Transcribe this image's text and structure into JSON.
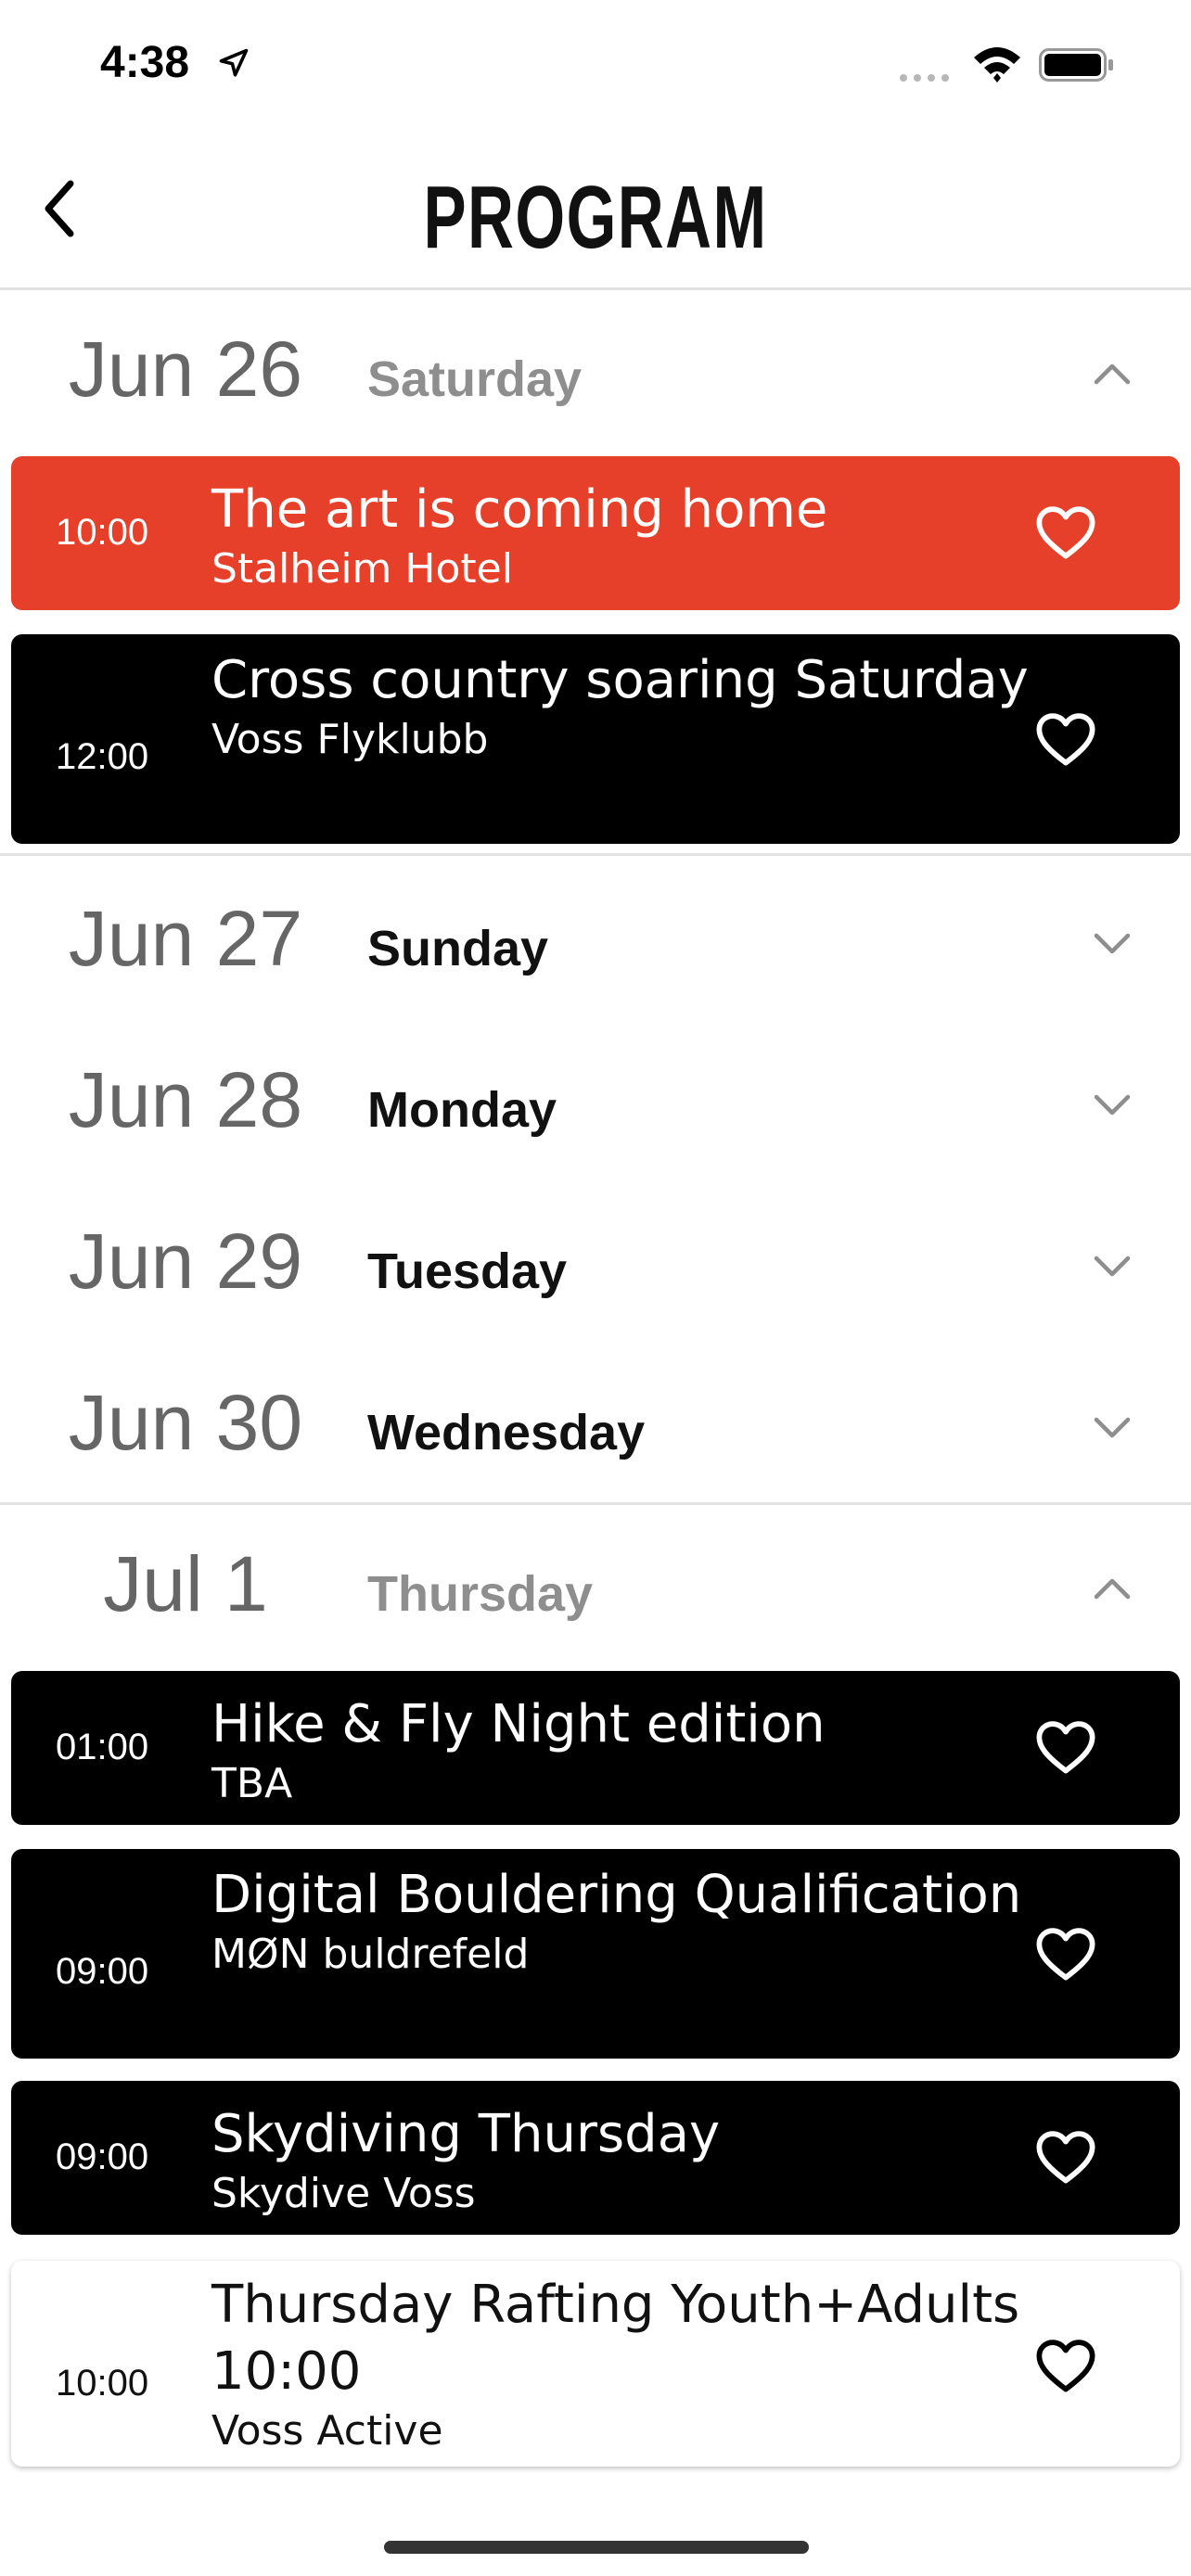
{
  "status_bar": {
    "time": "4:38"
  },
  "header": {
    "title": "PROGRAM"
  },
  "days": [
    {
      "date": "Jun 26",
      "weekday": "Saturday",
      "expanded": true
    },
    {
      "date": "Jun 27",
      "weekday": "Sunday",
      "expanded": false
    },
    {
      "date": "Jun 28",
      "weekday": "Monday",
      "expanded": false
    },
    {
      "date": "Jun 29",
      "weekday": "Tuesday",
      "expanded": false
    },
    {
      "date": "Jun 30",
      "weekday": "Wednesday",
      "expanded": false
    },
    {
      "date": "Jul 1",
      "weekday": "Thursday",
      "expanded": true
    }
  ],
  "events": [
    {
      "time": "10:00",
      "name": "The art is coming home",
      "location": "Stalheim Hotel",
      "style": "red"
    },
    {
      "time": "12:00",
      "name": "Cross country soaring Saturday",
      "location": "Voss Flyklubb",
      "style": "black"
    },
    {
      "time": "01:00",
      "name": "Hike & Fly Night edition",
      "location": "TBA",
      "style": "black"
    },
    {
      "time": "09:00",
      "name": "Digital Bouldering Qualification",
      "location": "MØN buldrefeld",
      "style": "black"
    },
    {
      "time": "09:00",
      "name": "Skydiving Thursday",
      "location": "Skydive Voss",
      "style": "black"
    },
    {
      "time": "10:00",
      "name": "Thursday Rafting Youth+Adults 10:00",
      "location": "Voss Active",
      "style": "white"
    }
  ],
  "icons": {
    "back": "chevron-left-icon",
    "collapse": "chevron-up-icon",
    "expand": "chevron-down-icon",
    "favorite": "heart-outline-icon"
  },
  "colors": {
    "accent_red": "#e6402b",
    "card_black": "#000000"
  }
}
